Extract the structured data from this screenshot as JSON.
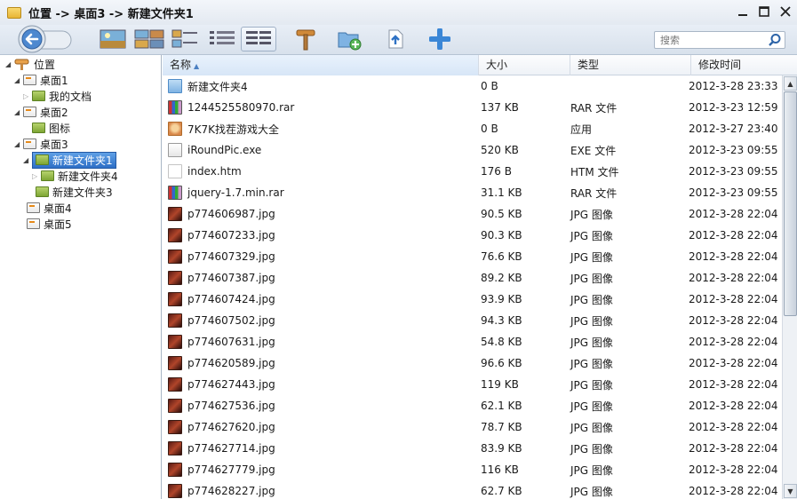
{
  "window": {
    "title": "位置 -> 桌面3 -> 新建文件夹1",
    "controls": {
      "minimize": "—",
      "maximize": "☐",
      "close": "✕"
    }
  },
  "toolbar": {
    "search_placeholder": "搜索",
    "view_icons": [
      "thumbnail-large-icon",
      "thumbnail-medium-icon",
      "tiles-icon",
      "list-icon",
      "details-icon"
    ],
    "actions": [
      "properties-icon",
      "new-folder-icon",
      "upload-icon",
      "add-icon"
    ]
  },
  "sidebar": {
    "root_label": "位置",
    "items": [
      {
        "label": "桌面1"
      },
      {
        "label": "我的文档"
      },
      {
        "label": "桌面2"
      },
      {
        "label": "图标"
      },
      {
        "label": "桌面3"
      },
      {
        "label": "新建文件夹1"
      },
      {
        "label": "新建文件夹4"
      },
      {
        "label": "新建文件夹3"
      },
      {
        "label": "桌面4"
      },
      {
        "label": "桌面5"
      }
    ],
    "selected": "新建文件夹1"
  },
  "columns": {
    "name": "名称",
    "size": "大小",
    "type": "类型",
    "modified": "修改时间"
  },
  "files": [
    {
      "name": "新建文件夹4",
      "size": "0 B",
      "type": "",
      "date": "2012-3-28 23:33",
      "icon": "folder"
    },
    {
      "name": "1244525580970.rar",
      "size": "137 KB",
      "type": "RAR 文件",
      "date": "2012-3-23 12:59",
      "icon": "rar"
    },
    {
      "name": "7K7K找茬游戏大全",
      "size": "0 B",
      "type": "应用",
      "date": "2012-3-27 23:40",
      "icon": "app"
    },
    {
      "name": "iRoundPic.exe",
      "size": "520 KB",
      "type": "EXE 文件",
      "date": "2012-3-23 09:55",
      "icon": "exe"
    },
    {
      "name": "index.htm",
      "size": "176 B",
      "type": "HTM 文件",
      "date": "2012-3-23 09:55",
      "icon": "htm"
    },
    {
      "name": "jquery-1.7.min.rar",
      "size": "31.1 KB",
      "type": "RAR 文件",
      "date": "2012-3-23 09:55",
      "icon": "rar"
    },
    {
      "name": "p774606987.jpg",
      "size": "90.5 KB",
      "type": "JPG 图像",
      "date": "2012-3-28 22:04",
      "icon": "jpg"
    },
    {
      "name": "p774607233.jpg",
      "size": "90.3 KB",
      "type": "JPG 图像",
      "date": "2012-3-28 22:04",
      "icon": "jpg"
    },
    {
      "name": "p774607329.jpg",
      "size": "76.6 KB",
      "type": "JPG 图像",
      "date": "2012-3-28 22:04",
      "icon": "jpg"
    },
    {
      "name": "p774607387.jpg",
      "size": "89.2 KB",
      "type": "JPG 图像",
      "date": "2012-3-28 22:04",
      "icon": "jpg"
    },
    {
      "name": "p774607424.jpg",
      "size": "93.9 KB",
      "type": "JPG 图像",
      "date": "2012-3-28 22:04",
      "icon": "jpg"
    },
    {
      "name": "p774607502.jpg",
      "size": "94.3 KB",
      "type": "JPG 图像",
      "date": "2012-3-28 22:04",
      "icon": "jpg"
    },
    {
      "name": "p774607631.jpg",
      "size": "54.8 KB",
      "type": "JPG 图像",
      "date": "2012-3-28 22:04",
      "icon": "jpg"
    },
    {
      "name": "p774620589.jpg",
      "size": "96.6 KB",
      "type": "JPG 图像",
      "date": "2012-3-28 22:04",
      "icon": "jpg"
    },
    {
      "name": "p774627443.jpg",
      "size": "119 KB",
      "type": "JPG 图像",
      "date": "2012-3-28 22:04",
      "icon": "jpg"
    },
    {
      "name": "p774627536.jpg",
      "size": "62.1 KB",
      "type": "JPG 图像",
      "date": "2012-3-28 22:04",
      "icon": "jpg"
    },
    {
      "name": "p774627620.jpg",
      "size": "78.7 KB",
      "type": "JPG 图像",
      "date": "2012-3-28 22:04",
      "icon": "jpg"
    },
    {
      "name": "p774627714.jpg",
      "size": "83.9 KB",
      "type": "JPG 图像",
      "date": "2012-3-28 22:04",
      "icon": "jpg"
    },
    {
      "name": "p774627779.jpg",
      "size": "116 KB",
      "type": "JPG 图像",
      "date": "2012-3-28 22:04",
      "icon": "jpg"
    },
    {
      "name": "p774628227.jpg",
      "size": "62.7 KB",
      "type": "JPG 图像",
      "date": "2012-3-28 22:04",
      "icon": "jpg"
    }
  ],
  "colors": {
    "accent": "#2e6fc6",
    "titlebar": "#e3e9f1",
    "selection": "#5fa0e6"
  }
}
